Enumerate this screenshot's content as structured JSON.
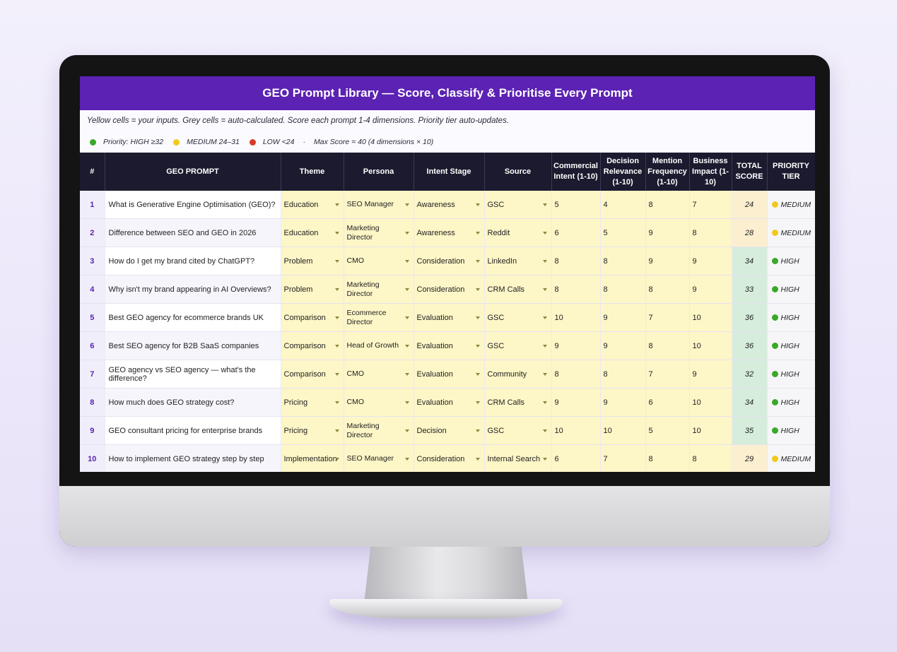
{
  "title": "GEO Prompt Library — Score, Classify & Prioritise Every Prompt",
  "instructions": "Yellow cells = your inputs. Grey cells = auto-calculated. Score each prompt 1-4 dimensions. Priority tier auto-updates.",
  "legend": {
    "prefix": "Priority: HIGH ≥32",
    "medium": "MEDIUM 24–31",
    "low": "LOW <24",
    "max": "Max Score = 40 (4 dimensions × 10)"
  },
  "colors": {
    "header_purple": "#5b22b3",
    "high": "#3aa829",
    "medium": "#f2c81c",
    "low": "#d83a2a"
  },
  "columns": [
    "#",
    "GEO PROMPT",
    "Theme",
    "Persona",
    "Intent Stage",
    "Source",
    "Commercial Intent (1-10)",
    "Decision Relevance (1-10)",
    "Mention Frequency (1-10)",
    "Business Impact (1-10)",
    "TOTAL SCORE",
    "PRIORITY TIER"
  ],
  "rows": [
    {
      "n": "1",
      "prompt": "What is Generative Engine Optimisation (GEO)?",
      "theme": "Education",
      "persona": "SEO Manager",
      "stage": "Awareness",
      "source": "GSC",
      "ci": "5",
      "dr": "4",
      "mf": "8",
      "bi": "7",
      "total": "24",
      "tier": "MEDIUM",
      "tier_level": "medium"
    },
    {
      "n": "2",
      "prompt": "Difference between SEO and GEO in 2026",
      "theme": "Education",
      "persona": "Marketing Director",
      "stage": "Awareness",
      "source": "Reddit",
      "ci": "6",
      "dr": "5",
      "mf": "9",
      "bi": "8",
      "total": "28",
      "tier": "MEDIUM",
      "tier_level": "medium"
    },
    {
      "n": "3",
      "prompt": "How do I get my brand cited by ChatGPT?",
      "theme": "Problem",
      "persona": "CMO",
      "stage": "Consideration",
      "source": "LinkedIn",
      "ci": "8",
      "dr": "8",
      "mf": "9",
      "bi": "9",
      "total": "34",
      "tier": "HIGH",
      "tier_level": "high"
    },
    {
      "n": "4",
      "prompt": "Why isn't my brand appearing in AI Overviews?",
      "theme": "Problem",
      "persona": "Marketing Director",
      "stage": "Consideration",
      "source": "CRM Calls",
      "ci": "8",
      "dr": "8",
      "mf": "8",
      "bi": "9",
      "total": "33",
      "tier": "HIGH",
      "tier_level": "high"
    },
    {
      "n": "5",
      "prompt": "Best GEO agency for ecommerce brands UK",
      "theme": "Comparison",
      "persona": "Ecommerce Director",
      "stage": "Evaluation",
      "source": "GSC",
      "ci": "10",
      "dr": "9",
      "mf": "7",
      "bi": "10",
      "total": "36",
      "tier": "HIGH",
      "tier_level": "high"
    },
    {
      "n": "6",
      "prompt": "Best SEO agency for B2B SaaS companies",
      "theme": "Comparison",
      "persona": "Head of Growth",
      "stage": "Evaluation",
      "source": "GSC",
      "ci": "9",
      "dr": "9",
      "mf": "8",
      "bi": "10",
      "total": "36",
      "tier": "HIGH",
      "tier_level": "high"
    },
    {
      "n": "7",
      "prompt": "GEO agency vs SEO agency — what's the difference?",
      "theme": "Comparison",
      "persona": "CMO",
      "stage": "Evaluation",
      "source": "Community",
      "ci": "8",
      "dr": "8",
      "mf": "7",
      "bi": "9",
      "total": "32",
      "tier": "HIGH",
      "tier_level": "high"
    },
    {
      "n": "8",
      "prompt": "How much does GEO strategy cost?",
      "theme": "Pricing",
      "persona": "CMO",
      "stage": "Evaluation",
      "source": "CRM Calls",
      "ci": "9",
      "dr": "9",
      "mf": "6",
      "bi": "10",
      "total": "34",
      "tier": "HIGH",
      "tier_level": "high"
    },
    {
      "n": "9",
      "prompt": "GEO consultant pricing for enterprise brands",
      "theme": "Pricing",
      "persona": "Marketing Director",
      "stage": "Decision",
      "source": "GSC",
      "ci": "10",
      "dr": "10",
      "mf": "5",
      "bi": "10",
      "total": "35",
      "tier": "HIGH",
      "tier_level": "high"
    },
    {
      "n": "10",
      "prompt": "How to implement GEO strategy step by step",
      "theme": "Implementation",
      "persona": "SEO Manager",
      "stage": "Consideration",
      "source": "Internal Search",
      "ci": "6",
      "dr": "7",
      "mf": "8",
      "bi": "8",
      "total": "29",
      "tier": "MEDIUM",
      "tier_level": "medium"
    }
  ]
}
